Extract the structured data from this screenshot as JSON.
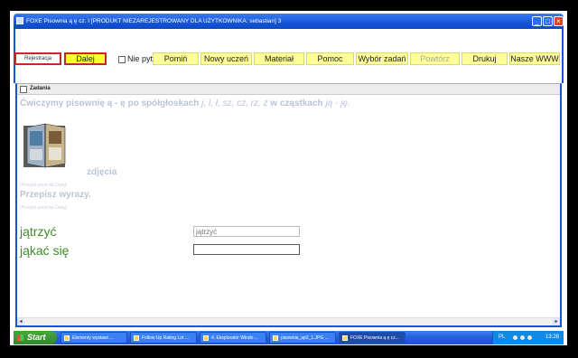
{
  "window": {
    "title": "FOXE Pisownia ą ę cz. I [PRODUKT NIEZAREJESTROWANY DLA UŻYTKOWNIKA: sebastian]  3"
  },
  "toolbar": {
    "register_label": "Rejestracja",
    "next_label": "Dalej",
    "no_ask_label": "Nie pytaj",
    "skip_label": "Pomiń",
    "new_student_label": "Nowy uczeń",
    "material_label": "Materiał",
    "help_label": "Pomoc",
    "task_select_label": "Wybór zadań",
    "repeat_label": "Powtórz",
    "print_label": "Drukuj",
    "www_label": "Nasze WWW"
  },
  "panel": {
    "header": "Zadania",
    "instruction_main": "Ćwiczymy pisownię ą - ę po spółgłoskach",
    "instruction_letters": "j, l, ł, sz, cz, rz, ż",
    "instruction_mid": " w cząstkach",
    "instruction_parts": " ją - ję.",
    "photo_label": "zdjęcia",
    "hint_small_1": "(Przejdź przycisk Dalej)",
    "copy_task": "Przepisz wyrazy.",
    "hint_small_2": "(Przejdź przycisk Dalej)",
    "words": [
      "jątrzyć",
      "jąkać się"
    ],
    "inputs": [
      {
        "value": "",
        "placeholder": "jątrzyć"
      },
      {
        "value": "",
        "placeholder": ""
      }
    ]
  },
  "taskbar": {
    "start_label": "Start",
    "tasks": [
      "Elementy wystawi ...",
      "Follow Up Rating Lot ...",
      "4. Eksplorator Windo ...",
      "pisownia_ap2_1.JPG ...",
      "FOXE Pisownia ą ę cz..."
    ],
    "tray_lang": "PL",
    "clock": "13:28"
  },
  "colors": {
    "titlebar": "#1555d8",
    "button_bg": "#ffff99",
    "accent_red": "#c62828",
    "word_green": "#3d8a2a",
    "muted_text": "#b8c5d8"
  }
}
